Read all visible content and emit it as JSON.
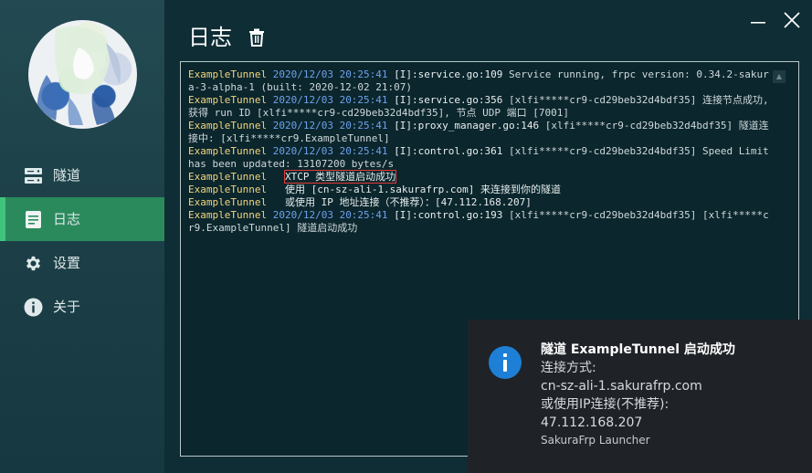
{
  "colors": {
    "accent": "#2a8a5c",
    "sidebar": "#1d4048",
    "console_bg": "#0b262d",
    "time": "#6fa2ec",
    "source": "#f2d57e",
    "highlight": "#e53935",
    "toast_icon": "#1e7fd6"
  },
  "sidebar": {
    "items": [
      {
        "label": "隧道",
        "icon": "server-icon",
        "active": false
      },
      {
        "label": "日志",
        "icon": "document-icon",
        "active": true
      },
      {
        "label": "设置",
        "icon": "gear-icon",
        "active": false
      },
      {
        "label": "关于",
        "icon": "info-icon",
        "active": false
      }
    ]
  },
  "header": {
    "title": "日志"
  },
  "log": {
    "lines": [
      {
        "src": "ExampleTunnel",
        "time": "2020/12/03 20:25:41",
        "level": "[I]:service.go:109",
        "msg": "Service running, frpc version: 0.34.2-sakura-3-alpha-1 (built: 2020-12-02 21:07)"
      },
      {
        "src": "ExampleTunnel",
        "time": "2020/12/03 20:25:41",
        "level": "[I]:service.go:356",
        "msg": "[xlfi*****cr9-cd29beb32d4bdf35] 连接节点成功, 获得 run ID [xlfi*****cr9-cd29beb32d4bdf35], 节点 UDP 端口 [7001]"
      },
      {
        "src": "ExampleTunnel",
        "time": "2020/12/03 20:25:41",
        "level": "[I]:proxy_manager.go:146",
        "msg": "[xlfi*****cr9-cd29beb32d4bdf35] 隧道连接中: [xlfi*****cr9.ExampleTunnel]"
      },
      {
        "src": "ExampleTunnel",
        "time": "2020/12/03 20:25:41",
        "level": "[I]:control.go:361",
        "msg": "[xlfi*****cr9-cd29beb32d4bdf35] Speed Limit has been updated: 13107200 bytes/s"
      },
      {
        "src": "ExampleTunnel",
        "time": "",
        "level": "",
        "msg": "XTCP 类型隧道启动成功",
        "highlight": true
      },
      {
        "src": "ExampleTunnel",
        "time": "",
        "level": "",
        "msg": "使用 [cn-sz-ali-1.sakurafrp.com] 来连接到你的隧道"
      },
      {
        "src": "ExampleTunnel",
        "time": "",
        "level": "",
        "msg": "或使用 IP 地址连接（不推荐）：[47.112.168.207]"
      },
      {
        "src": "ExampleTunnel",
        "time": "2020/12/03 20:25:41",
        "level": "[I]:control.go:193",
        "msg": "[xlfi*****cr9-cd29beb32d4bdf35] [xlfi*****cr9.ExampleTunnel] 隧道启动成功"
      }
    ]
  },
  "toast": {
    "icon": "info-icon",
    "title": "隧道 ExampleTunnel 启动成功",
    "line1": "连接方式:",
    "line2": "cn-sz-ali-1.sakurafrp.com",
    "line3": "或使用IP连接(不推荐):",
    "line4": "47.112.168.207",
    "app": "SakuraFrp Launcher"
  }
}
